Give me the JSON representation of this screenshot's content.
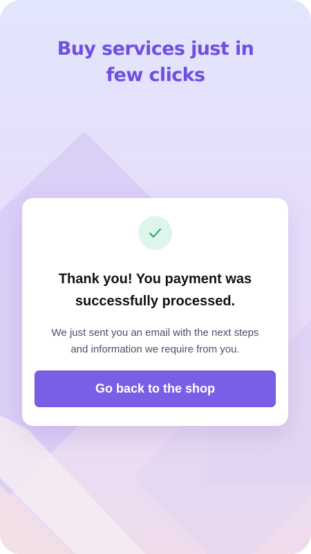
{
  "colors": {
    "accent": "#6e4fe0",
    "button": "#7b5ee6",
    "success_badge": "#dff5ec",
    "success_check": "#21a36a"
  },
  "header": {
    "title_line1": "Buy services just in",
    "title_line2": "few clicks"
  },
  "confirmation": {
    "icon": "checkmark-icon",
    "title_line1": "Thank you! You payment was",
    "title_line2": "successfully processed.",
    "message_line1": "We just sent you an email with the next steps",
    "message_line2": "and information we require from you.",
    "button_label": "Go back to the shop"
  }
}
